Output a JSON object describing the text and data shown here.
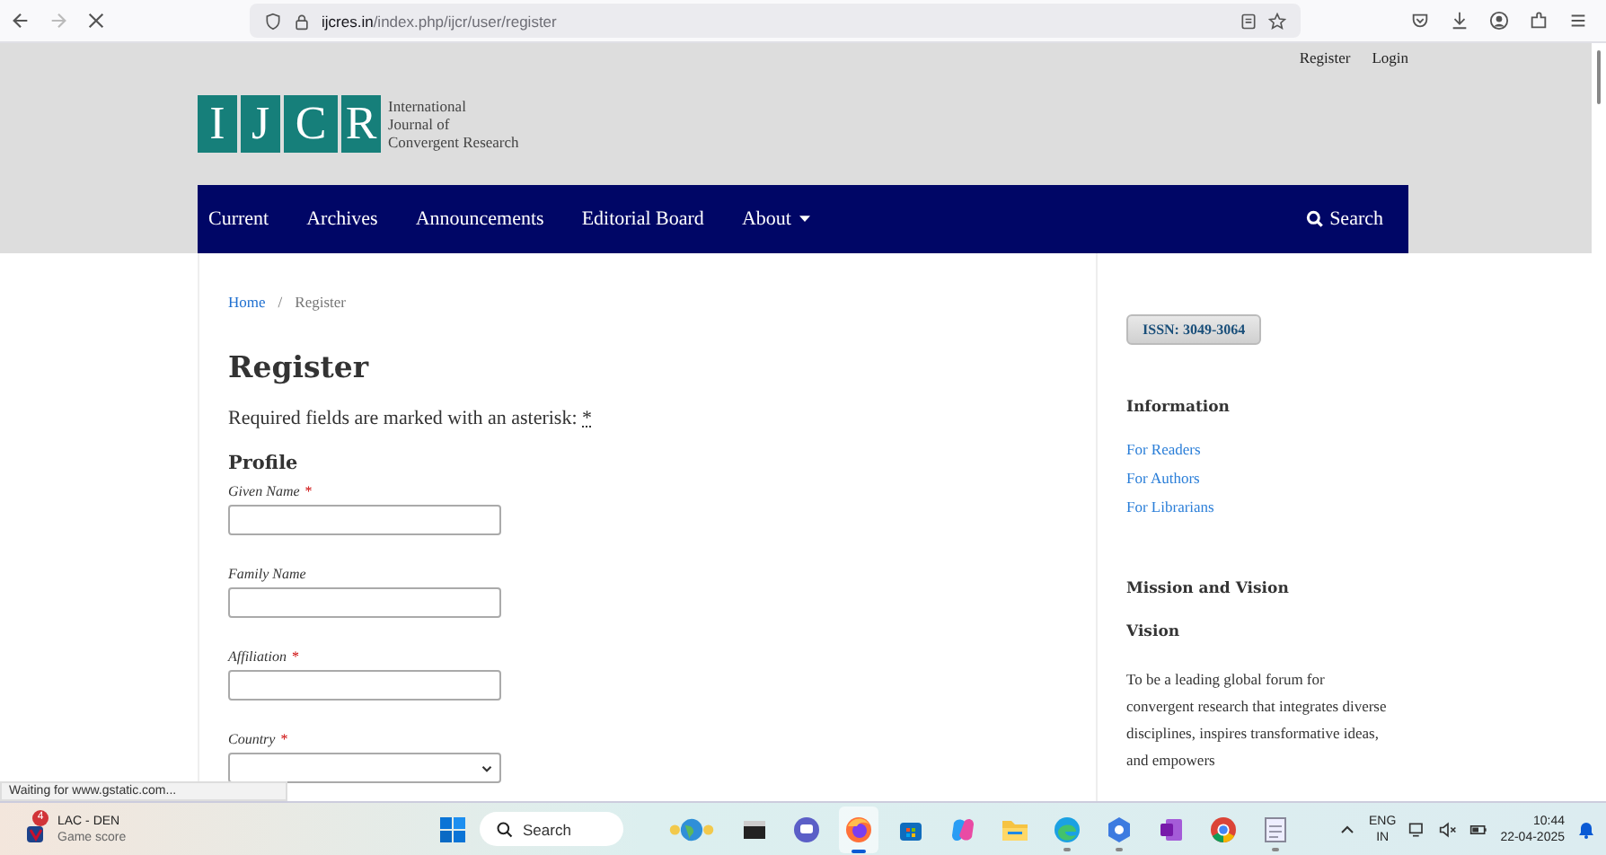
{
  "browser": {
    "url_host": "ijcres.in",
    "url_path": "/index.php/ijcr/user/register",
    "status_text": "Waiting for www.gstatic.com..."
  },
  "header": {
    "user_links": [
      "Register",
      "Login"
    ],
    "logo_letters": [
      "I",
      "J",
      "C",
      "R"
    ],
    "logo_text": [
      "International",
      "Journal of",
      "Convergent Research"
    ]
  },
  "nav": {
    "items": [
      {
        "label": "Current",
        "dropdown": false
      },
      {
        "label": "Archives",
        "dropdown": false
      },
      {
        "label": "Announcements",
        "dropdown": false
      },
      {
        "label": "Editorial Board",
        "dropdown": false
      },
      {
        "label": "About",
        "dropdown": true
      }
    ],
    "search": "Search"
  },
  "breadcrumb": {
    "home": "Home",
    "separator": "/",
    "current": "Register"
  },
  "title": "Register",
  "required_note": {
    "text": "Required fields are marked with an asterisk:",
    "mark": "*"
  },
  "section": "Profile",
  "fields": [
    {
      "label": "Given Name",
      "required_mark": "*",
      "kind": "text"
    },
    {
      "label": "Family Name",
      "kind": "text"
    },
    {
      "label": "Affiliation",
      "required_mark": "*",
      "kind": "text"
    },
    {
      "label": "Country",
      "required_mark": "*",
      "kind": "select"
    }
  ],
  "sidebar": {
    "issn": "ISSN: 3049-3064",
    "info_title": "Information",
    "links": [
      "For Readers",
      "For Authors",
      "For Librarians"
    ],
    "mission_title": "Mission and Vision",
    "vision_title": "Vision",
    "vision_text": "To be a leading global forum for convergent research that integrates diverse disciplines, inspires transformative ideas, and empowers"
  },
  "taskbar": {
    "widget": {
      "badge": "4",
      "title": "LAC - DEN",
      "subtitle": "Game score"
    },
    "search": "Search",
    "apps": [
      {
        "kind": "widgets",
        "active": false,
        "running": false
      },
      {
        "kind": "terminal",
        "active": false,
        "running": false
      },
      {
        "kind": "chat",
        "active": false,
        "running": false
      },
      {
        "kind": "firefox",
        "active": true,
        "running": false
      },
      {
        "kind": "store",
        "active": false,
        "running": false
      },
      {
        "kind": "copilot",
        "active": false,
        "running": false
      },
      {
        "kind": "folder",
        "active": false,
        "running": false
      },
      {
        "kind": "edge",
        "active": false,
        "running": true
      },
      {
        "kind": "hub",
        "active": false,
        "running": true
      },
      {
        "kind": "onenote",
        "active": false,
        "running": false
      },
      {
        "kind": "chrome",
        "active": false,
        "running": false
      },
      {
        "kind": "notepad",
        "active": false,
        "running": true
      }
    ],
    "lang": "ENG",
    "region": "IN",
    "time": "10:44",
    "date": "22-04-2025"
  }
}
